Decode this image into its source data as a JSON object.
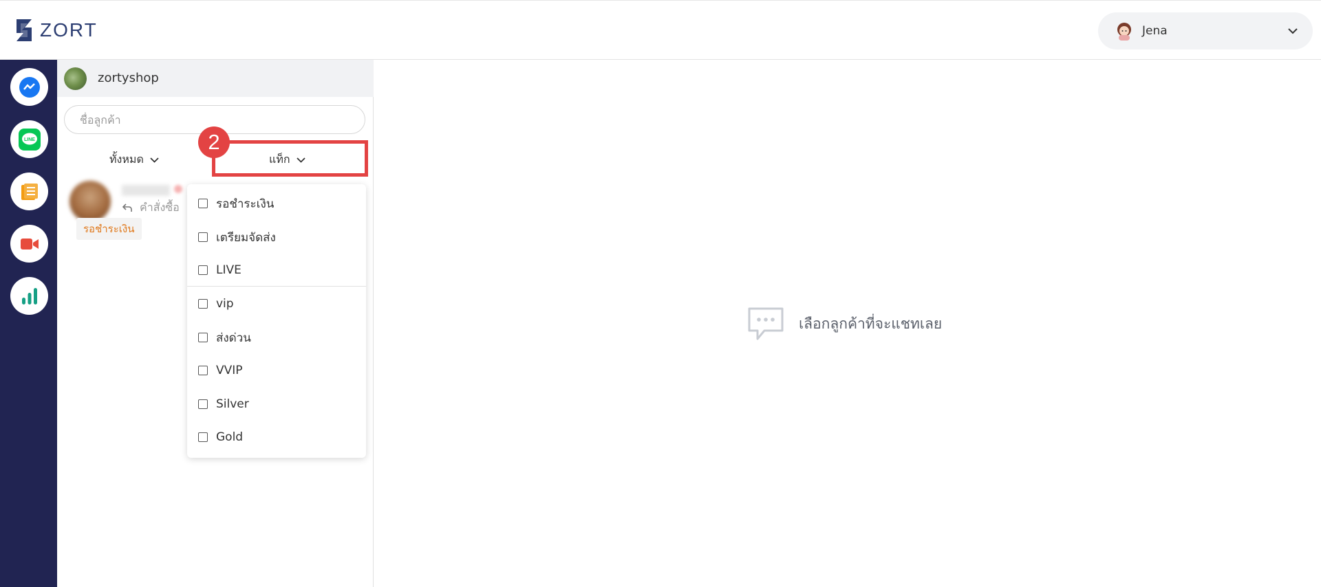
{
  "header": {
    "logo_text": "ZORT",
    "user": {
      "name": "Jena"
    }
  },
  "nav": {
    "items": [
      {
        "name": "messenger",
        "color": "#1877f2"
      },
      {
        "name": "line",
        "color": "#06c755"
      },
      {
        "name": "orders",
        "color": "#f39c12"
      },
      {
        "name": "live",
        "color": "#e74c3c"
      },
      {
        "name": "analytics",
        "color": "#16a085"
      }
    ]
  },
  "sidebar": {
    "shop_name": "zortyshop",
    "search_placeholder": "ชื่อลูกค้า",
    "filter_all_label": "ทั้งหมด",
    "filter_tag_label": "แท็ก",
    "step_number": "2",
    "chat_preview": "คำสั่งซื้อ",
    "chat_tag": "รอชำระเงิน"
  },
  "tag_dropdown": {
    "options": [
      {
        "label": "รอชำระเงิน",
        "checked": false
      },
      {
        "label": "เตรียมจัดส่ง",
        "checked": false
      },
      {
        "label": "LIVE",
        "checked": false
      },
      {
        "label": "vip",
        "checked": false
      },
      {
        "label": "ส่งด่วน",
        "checked": false
      },
      {
        "label": "VVIP",
        "checked": false
      },
      {
        "label": "Silver",
        "checked": false
      },
      {
        "label": "Gold",
        "checked": false
      }
    ]
  },
  "main": {
    "empty_message": "เลือกลูกค้าที่จะแชทเลย"
  },
  "colors": {
    "nav_bg": "#212452",
    "highlight": "#e34343",
    "tag_text": "#e07a1e"
  }
}
